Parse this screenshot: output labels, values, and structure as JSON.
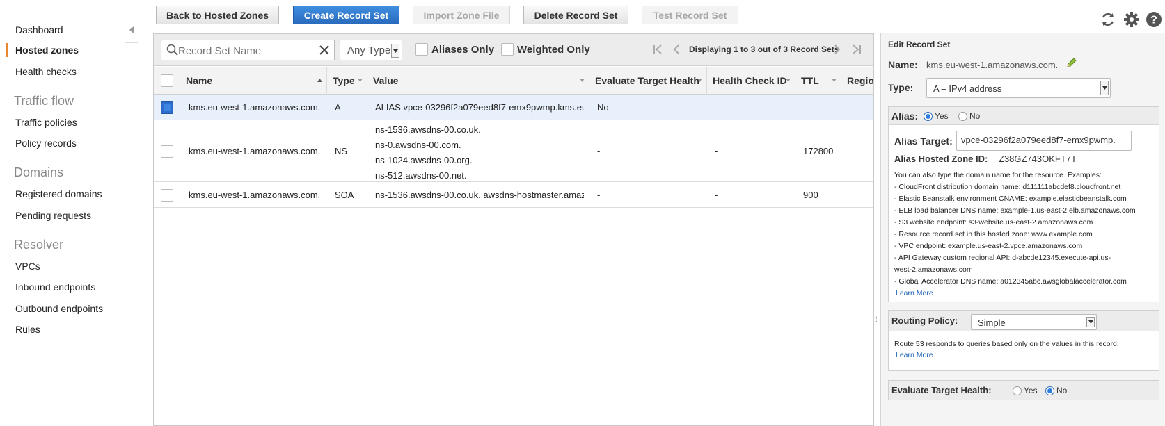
{
  "sidebar": {
    "items": [
      {
        "label": "Dashboard"
      },
      {
        "label": "Hosted zones",
        "active": true
      },
      {
        "label": "Health checks"
      }
    ],
    "sections": [
      {
        "title": "Traffic flow",
        "items": [
          "Traffic policies",
          "Policy records"
        ]
      },
      {
        "title": "Domains",
        "items": [
          "Registered domains",
          "Pending requests"
        ]
      },
      {
        "title": "Resolver",
        "items": [
          "VPCs",
          "Inbound endpoints",
          "Outbound endpoints",
          "Rules"
        ]
      }
    ]
  },
  "toolbar": {
    "back": "Back to Hosted Zones",
    "create": "Create Record Set",
    "import": "Import Zone File",
    "delete": "Delete Record Set",
    "test": "Test Record Set"
  },
  "filter": {
    "search_placeholder": "Record Set Name",
    "type_value": "Any Type",
    "aliases_only": "Aliases Only",
    "weighted_only": "Weighted Only",
    "pager": "Displaying 1 to 3 out of 3 Record Sets"
  },
  "table": {
    "columns": [
      "Name",
      "Type",
      "Value",
      "Evaluate Target Health",
      "Health Check ID",
      "TTL",
      "Regio"
    ],
    "rows": [
      {
        "name": "kms.eu-west-1.amazonaws.com.",
        "type": "A",
        "value": [
          "ALIAS vpce-03296f2a079eed8f7-emx9pwmp.kms.eu"
        ],
        "eth": "No",
        "hcid": "-",
        "ttl": "",
        "selected": true
      },
      {
        "name": "kms.eu-west-1.amazonaws.com.",
        "type": "NS",
        "value": [
          "ns-1536.awsdns-00.co.uk.",
          "ns-0.awsdns-00.com.",
          "ns-1024.awsdns-00.org.",
          "ns-512.awsdns-00.net."
        ],
        "eth": "-",
        "hcid": "-",
        "ttl": "172800",
        "selected": false
      },
      {
        "name": "kms.eu-west-1.amazonaws.com.",
        "type": "SOA",
        "value": [
          "ns-1536.awsdns-00.co.uk. awsdns-hostmaster.amaz"
        ],
        "eth": "-",
        "hcid": "-",
        "ttl": "900",
        "selected": false
      }
    ]
  },
  "panel": {
    "title": "Edit Record Set",
    "name_label": "Name:",
    "name_value": "kms.eu-west-1.amazonaws.com.",
    "type_label": "Type:",
    "type_value": "A – IPv4 address",
    "alias_label": "Alias:",
    "alias_yes": "Yes",
    "alias_no": "No",
    "alias_target_label": "Alias Target:",
    "alias_target_value": "vpce-03296f2a079eed8f7-emx9pwmp.",
    "alias_zone_label": "Alias Hosted Zone ID:",
    "alias_zone_value": "Z38GZ743OKFT7T",
    "help_intro": "You can also type the domain name for the resource. Examples:",
    "help_lines": [
      "-  CloudFront distribution domain name: d111111abcdef8.cloudfront.net",
      "-  Elastic Beanstalk environment CNAME: example.elasticbeanstalk.com",
      "-  ELB load balancer DNS name: example-1.us-east-2.elb.amazonaws.com",
      "-  S3 website endpoint: s3-website.us-east-2.amazonaws.com",
      "-  Resource record set in this hosted zone: www.example.com",
      "-  VPC endpoint: example.us-east-2.vpce.amazonaws.com",
      "-  API Gateway custom regional API: d-abcde12345.execute-api.us-",
      "west-2.amazonaws.com",
      "-  Global Accelerator DNS name: a012345abc.awsglobalaccelerator.com"
    ],
    "learn_more": "Learn More",
    "routing_label": "Routing Policy:",
    "routing_value": "Simple",
    "routing_help": "Route 53 responds to queries based only on the values in this record.",
    "eth_label": "Evaluate Target Health:",
    "eth_yes": "Yes",
    "eth_no": "No"
  }
}
